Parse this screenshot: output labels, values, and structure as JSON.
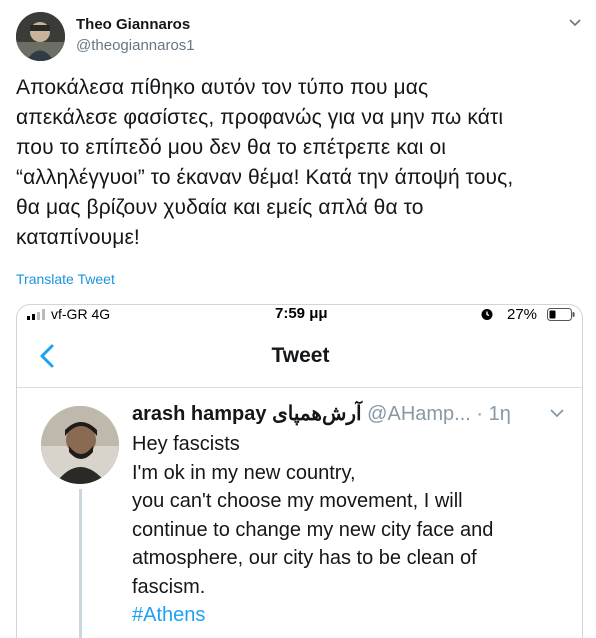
{
  "author": {
    "name": "Theo Giannaros",
    "handle": "@theogiannaros1"
  },
  "tweet": {
    "lines": [
      "Αποκάλεσα πίθηκο αυτόν τον τύπο που μας",
      "απεκάλεσε φασίστες, προφανώς για να μην πω κάτι",
      "που το επίπεδό μου δεν θα το επέτρεπε και οι",
      "“αλληλέγγυοι” το έκαναν θέμα! Κατά την άποψή τους,",
      "θα μας βρίζουν χυδαία  και εμείς απλά θα το",
      "καταπίνουμε!"
    ],
    "translate_label": "Translate Tweet"
  },
  "screenshot": {
    "status_bar": {
      "carrier": "vf-GR   4G",
      "time": "7:59 μμ",
      "battery": "27%"
    },
    "nav_title": "Tweet",
    "embedded_tweet": {
      "name": "arash hampay",
      "name_rtl": "آرش‌همپای",
      "handle_time": "@AHamp... · 1η",
      "lines": [
        "Hey fascists",
        "I'm ok in my new country,",
        "you can't choose my movement, I will",
        "continue to change my new city face and",
        "atmosphere, our city has to be clean of",
        "fascism."
      ],
      "hashtag": "#Athens"
    }
  },
  "colors": {
    "link": "#1b95e0",
    "hashtag": "#1da1f2",
    "muted": "#657786",
    "border": "#ccd6dd"
  },
  "icons": [
    "chevron-down-icon",
    "signal-icon",
    "alarm-icon",
    "battery-icon",
    "back-arrow-icon"
  ]
}
